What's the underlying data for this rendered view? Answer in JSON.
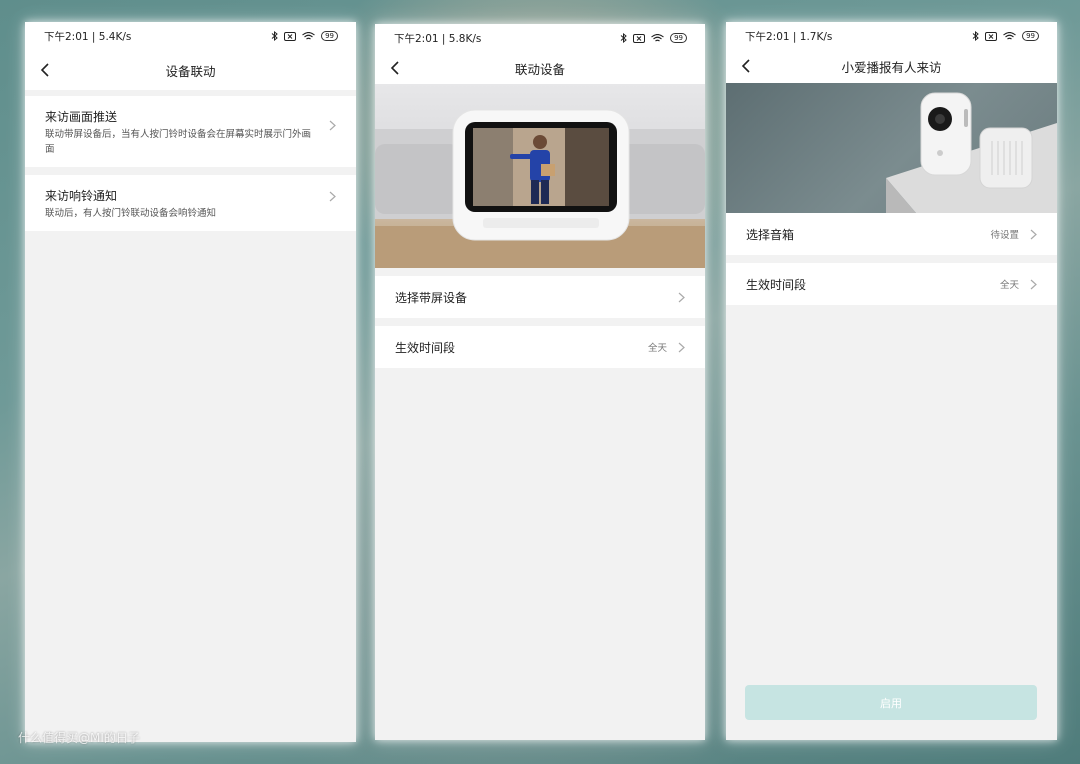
{
  "screens": [
    {
      "status": {
        "time": "下午2:01 | 5.4K/s",
        "battery": "99"
      },
      "title": "设备联动",
      "items": [
        {
          "title": "来访画面推送",
          "desc": "联动带屏设备后，当有人按门铃时设备会在屏幕实时展示门外画面"
        },
        {
          "title": "来访响铃通知",
          "desc": "联动后，有人按门铃联动设备会响铃通知"
        }
      ]
    },
    {
      "status": {
        "time": "下午2:01 | 5.8K/s",
        "battery": "99"
      },
      "title": "联动设备",
      "rows": [
        {
          "label": "选择带屏设备",
          "value": ""
        },
        {
          "label": "生效时间段",
          "value": "全天"
        }
      ]
    },
    {
      "status": {
        "time": "下午2:01 | 1.7K/s",
        "battery": "99"
      },
      "title": "小爱播报有人来访",
      "rows": [
        {
          "label": "选择音箱",
          "value": "待设置"
        },
        {
          "label": "生效时间段",
          "value": "全天"
        }
      ],
      "button": "启用"
    }
  ],
  "watermark": "什么值得买@MI的日子",
  "icons": [
    "back-arrow-icon",
    "chevron-right-icon",
    "bluetooth-icon",
    "sim-icon",
    "wifi-icon",
    "battery-icon"
  ],
  "colors": {
    "accent_button": "#c6e4e2",
    "page_bg": "#f2f2f2"
  }
}
